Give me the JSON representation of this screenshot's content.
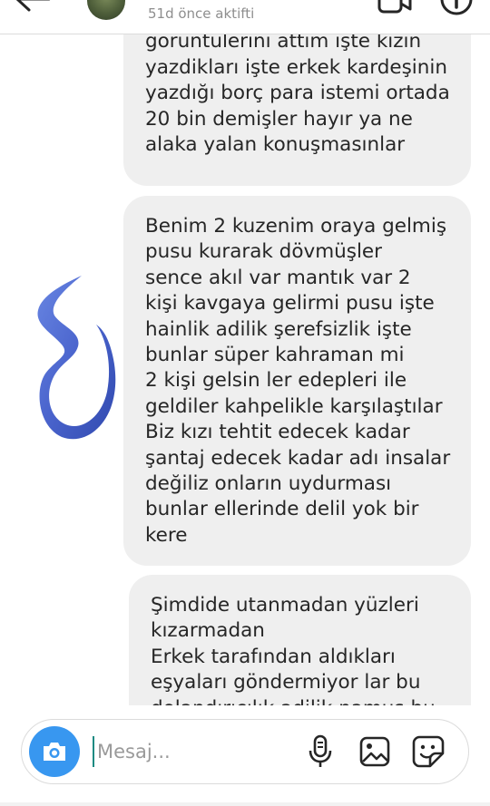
{
  "header": {
    "status": "51d önce aktifti"
  },
  "messages": [
    {
      "text": "Ben sana bazı ekran\ngörüntülerini attım işte kızın\nyazdikları işte erkek kardeşinin\nyazdığı borç para istemi ortada\n20 bin demişler hayır ya ne\nalaka yalan konuşmasınlar"
    },
    {
      "text": "Benim 2 kuzenim oraya gelmiş\npusu kurarak dövmüşler\nsence akıl var mantık var 2\nkişi kavgaya gelirmi pusu işte\nhainlik adilik şerefsizlik işte\nbunlar süper kahraman mi\n2 kişi gelsin ler edepleri ile\ngeldiler kahpelikle karşılaştılar\nBiz kızı tehtit edecek kadar\nşantaj edecek kadar adı insalar\ndeğiliz onların uydurması\nbunlar ellerinde delil yok bir\nkere"
    },
    {
      "text": "Şimdide utanmadan yüzleri\nkızarmadan\nErkek tarafından aldıkları\neşyaları göndermiyor lar bu\ndolandırıcılık adilik namus bu"
    }
  ],
  "composer": {
    "placeholder": "Mesaj..."
  },
  "icons": {
    "back": "arrow-left-icon",
    "video": "video-camera-icon",
    "info": "info-icon",
    "camera": "camera-icon",
    "mic": "microphone-icon",
    "gallery": "image-icon",
    "sticker": "sticker-icon"
  },
  "colors": {
    "bubble": "#efefef",
    "camera_button": "#3897f0",
    "logo_blue": "#3a56c8",
    "status_text": "#8e8e8e"
  }
}
